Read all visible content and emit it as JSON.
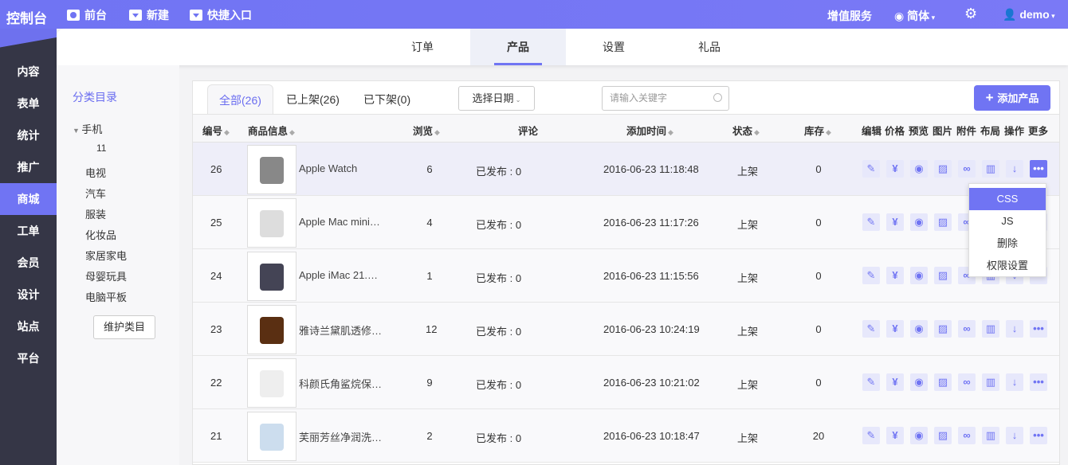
{
  "topbar": {
    "brand": "控制台",
    "nav": [
      {
        "icon": "eye-icon",
        "label": "前台"
      },
      {
        "icon": "dropdown-icon",
        "label": "新建"
      },
      {
        "icon": "dropdown-icon",
        "label": "快捷入口"
      }
    ],
    "value_service": "增值服务",
    "lang": "简体",
    "user": "demo"
  },
  "sidebar": {
    "items": [
      "内容",
      "表单",
      "统计",
      "推广",
      "商城",
      "工单",
      "会员",
      "设计",
      "站点",
      "平台"
    ],
    "active": "商城"
  },
  "tabs": [
    "订单",
    "产品",
    "设置",
    "礼品"
  ],
  "category": {
    "title": "分类目录",
    "items": [
      "手机",
      "11",
      "电视",
      "汽车",
      "服装",
      "化妆品",
      "家居家电",
      "母婴玩具",
      "电脑平板"
    ],
    "button": "维护类目"
  },
  "filters": {
    "tabs": [
      "全部(26)",
      "已上架(26)",
      "已下架(0)"
    ],
    "date": "选择日期",
    "search_placeholder": "请输入关键字",
    "add": "添加产品"
  },
  "columns": [
    "编号",
    "商品信息",
    "浏览",
    "评论",
    "添加时间",
    "状态",
    "库存",
    "编辑",
    "价格",
    "预览",
    "图片",
    "附件",
    "布局",
    "操作",
    "更多"
  ],
  "rows": [
    {
      "id": "26",
      "name": "Apple Watch",
      "views": "6",
      "comments": "已发布 : 0",
      "time": "2016-06-23 11:18:48",
      "status": "上架",
      "stock": "0"
    },
    {
      "id": "25",
      "name": "Apple Mac mini…",
      "views": "4",
      "comments": "已发布 : 0",
      "time": "2016-06-23 11:17:26",
      "status": "上架",
      "stock": "0"
    },
    {
      "id": "24",
      "name": "Apple iMac 21.…",
      "views": "1",
      "comments": "已发布 : 0",
      "time": "2016-06-23 11:15:56",
      "status": "上架",
      "stock": "0"
    },
    {
      "id": "23",
      "name": "雅诗兰黛肌透修…",
      "views": "12",
      "comments": "已发布 : 0",
      "time": "2016-06-23 10:24:19",
      "status": "上架",
      "stock": "0"
    },
    {
      "id": "22",
      "name": "科颜氏角鲨烷保…",
      "views": "9",
      "comments": "已发布 : 0",
      "time": "2016-06-23 10:21:02",
      "status": "上架",
      "stock": "0"
    },
    {
      "id": "21",
      "name": "芙丽芳丝净润洗…",
      "views": "2",
      "comments": "已发布 : 0",
      "time": "2016-06-23 10:18:47",
      "status": "上架",
      "stock": "20"
    }
  ],
  "menu": [
    "CSS",
    "JS",
    "删除",
    "权限设置"
  ],
  "colors": {
    "accent": "#7074f3",
    "sidebar": "#353646"
  }
}
